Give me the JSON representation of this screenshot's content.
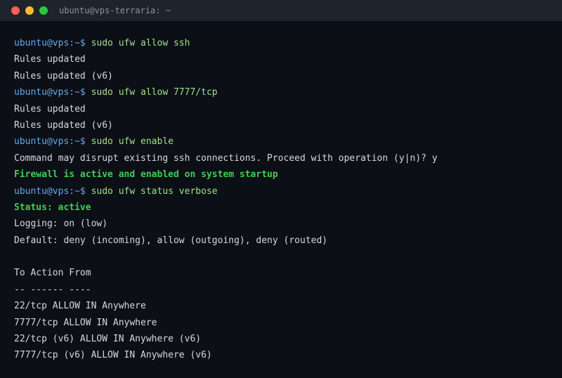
{
  "window": {
    "title": "ubuntu@vps-terraria: ~"
  },
  "terminal": {
    "prompt": "ubuntu@vps:~$",
    "lines": [
      {
        "type": "cmd",
        "text": "sudo ufw allow ssh"
      },
      {
        "type": "out",
        "text": "Rules updated"
      },
      {
        "type": "out",
        "text": "Rules updated (v6)"
      },
      {
        "type": "cmd",
        "text": "sudo ufw allow 7777/tcp"
      },
      {
        "type": "out",
        "text": "Rules updated"
      },
      {
        "type": "out",
        "text": "Rules updated (v6)"
      },
      {
        "type": "cmd",
        "text": "sudo ufw enable"
      },
      {
        "type": "out",
        "text": "Command may disrupt existing ssh connections. Proceed with operation (y|n)? y"
      },
      {
        "type": "ok",
        "text": "Firewall is active and enabled on system startup"
      },
      {
        "type": "cmd",
        "text": "sudo ufw status verbose"
      },
      {
        "type": "ok",
        "text": "Status: active"
      },
      {
        "type": "out",
        "text": "Logging: on (low)"
      },
      {
        "type": "out",
        "text": "Default: deny (incoming), allow (outgoing), deny (routed)"
      },
      {
        "type": "out",
        "text": ""
      },
      {
        "type": "out",
        "text": "To Action From"
      },
      {
        "type": "out",
        "text": "-- ------ ----"
      },
      {
        "type": "out",
        "text": "22/tcp ALLOW IN Anywhere"
      },
      {
        "type": "out",
        "text": "7777/tcp ALLOW IN Anywhere"
      },
      {
        "type": "out",
        "text": "22/tcp (v6) ALLOW IN Anywhere (v6)"
      },
      {
        "type": "out",
        "text": "7777/tcp (v6) ALLOW IN Anywhere (v6)"
      }
    ]
  },
  "colors": {
    "background": "#0c0f16",
    "prompt": "#6aa7e8",
    "command": "#9ee38a",
    "success": "#3fcf54",
    "output": "#d6d9de"
  }
}
